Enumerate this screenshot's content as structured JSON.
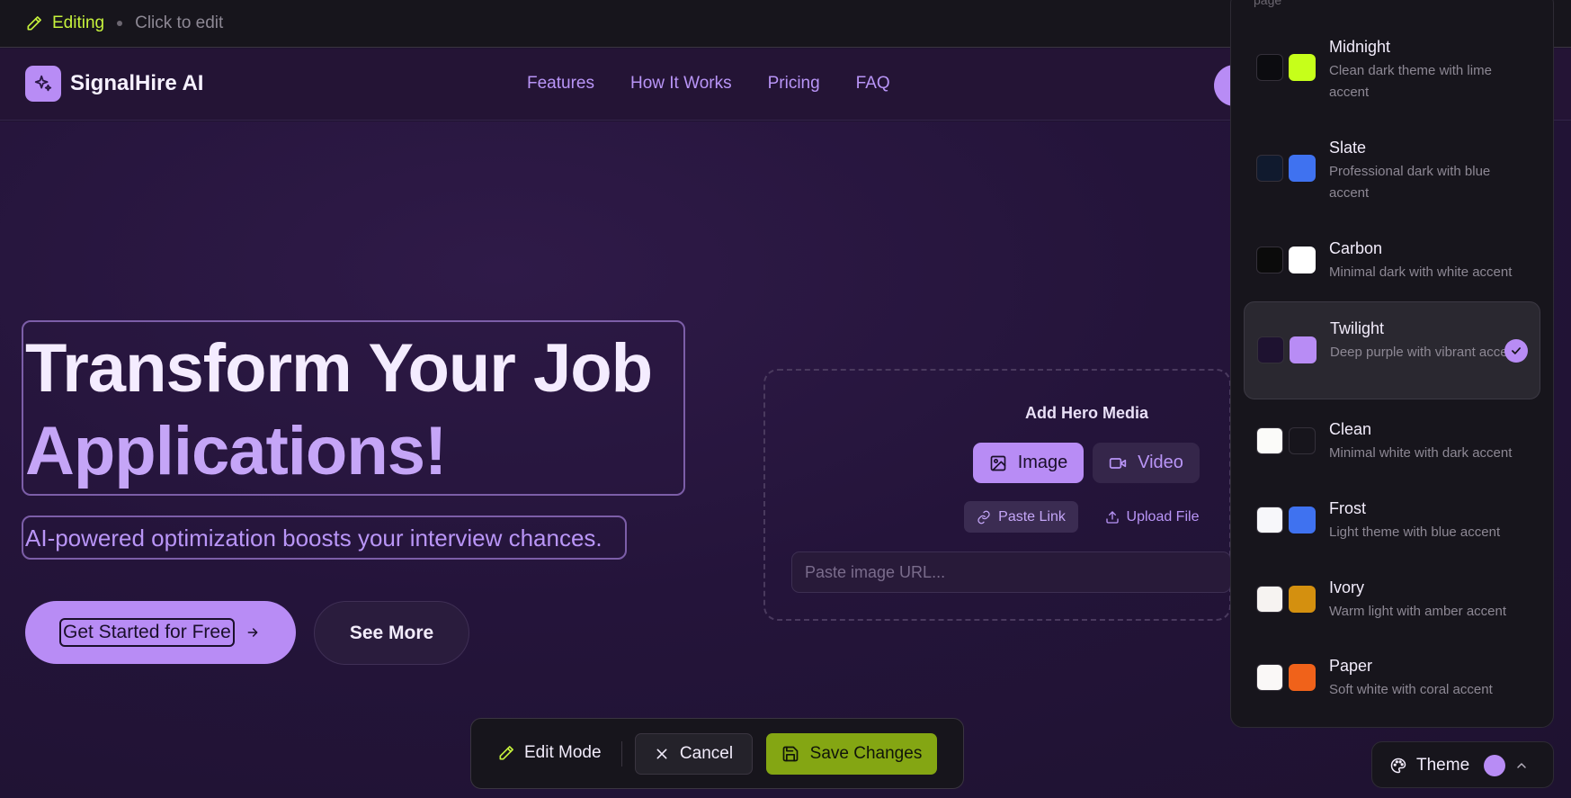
{
  "edit_bar": {
    "status": "Editing",
    "hint": "Click to edit"
  },
  "nav": {
    "brand": "SignalHire AI",
    "links": [
      "Features",
      "How It Works",
      "Pricing",
      "FAQ"
    ]
  },
  "hero": {
    "headline_line1": "Transform Your Job",
    "headline_line2": "Applications!",
    "subheadline": "AI-powered optimization boosts your interview chances.",
    "primary_cta": "Get Started for Free",
    "secondary_cta": "See More"
  },
  "media": {
    "title": "Add Hero Media",
    "tabs": [
      "Image",
      "Video"
    ],
    "options": [
      "Paste Link",
      "Upload File"
    ],
    "url_placeholder": "Paste image URL..."
  },
  "toolbar": {
    "edit_mode": "Edit Mode",
    "cancel": "Cancel",
    "save": "Save Changes"
  },
  "theme_panel": {
    "top_text": "page",
    "selected": "Twilight",
    "themes": [
      {
        "name": "Midnight",
        "desc": "Clean dark theme with lime accent",
        "bg": "#0c0c10",
        "accent": "#c6ff1a"
      },
      {
        "name": "Slate",
        "desc": "Professional dark with blue accent",
        "bg": "#101a2e",
        "accent": "#3f72f0"
      },
      {
        "name": "Carbon",
        "desc": "Minimal dark with white accent",
        "bg": "#0b0b0b",
        "accent": "#ffffff"
      },
      {
        "name": "Twilight",
        "desc": "Deep purple with vibrant accent",
        "bg": "#1e1230",
        "accent": "#b88cf5"
      },
      {
        "name": "Clean",
        "desc": "Minimal white with dark accent",
        "bg": "#fbfbf9",
        "accent": "#17151c"
      },
      {
        "name": "Frost",
        "desc": "Light theme with blue accent",
        "bg": "#f7f7fa",
        "accent": "#3f72f0"
      },
      {
        "name": "Ivory",
        "desc": "Warm light with amber accent",
        "bg": "#f6f3f1",
        "accent": "#d4900f"
      },
      {
        "name": "Paper",
        "desc": "Soft white with coral accent",
        "bg": "#faf8f7",
        "accent": "#f0621a"
      }
    ]
  },
  "theme_button": {
    "label": "Theme",
    "current_color": "#b88cf5"
  },
  "colors": {
    "accent": "#b88cf5",
    "lime": "#c6f23c",
    "save": "#84a613"
  }
}
